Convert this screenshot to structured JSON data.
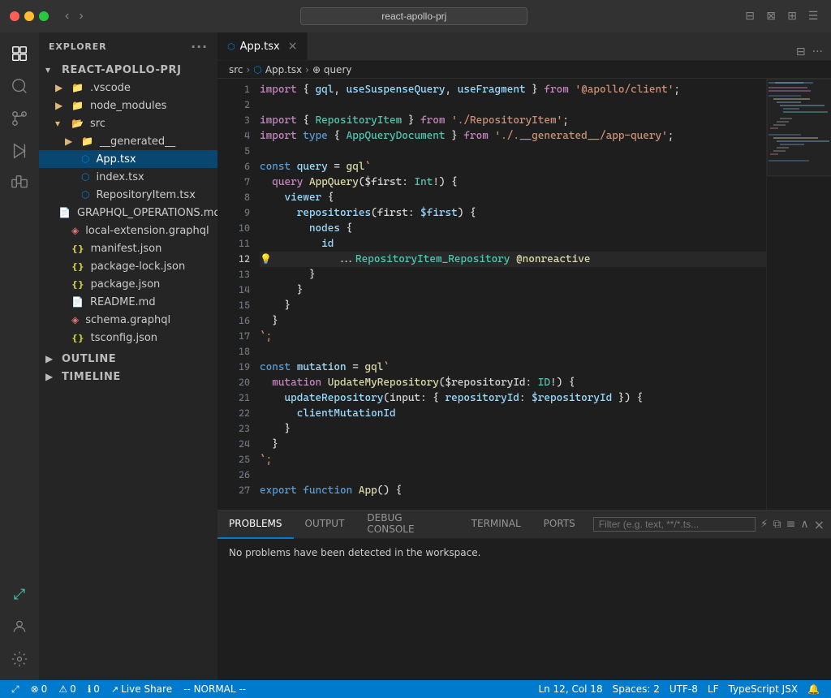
{
  "titlebar": {
    "search_placeholder": "react-apollo-prj",
    "icons": [
      "⊞",
      "⊟",
      "⊠"
    ]
  },
  "activity_bar": {
    "items": [
      {
        "id": "explorer",
        "icon": "⎘",
        "active": true
      },
      {
        "id": "search",
        "icon": "⌕"
      },
      {
        "id": "source-control",
        "icon": "⑂"
      },
      {
        "id": "run",
        "icon": "▷"
      },
      {
        "id": "extensions",
        "icon": "⊞"
      }
    ],
    "bottom": [
      {
        "id": "remote",
        "icon": "⤢"
      },
      {
        "id": "account",
        "icon": "👤"
      },
      {
        "id": "settings",
        "icon": "⚙"
      }
    ]
  },
  "sidebar": {
    "title": "EXPLORER",
    "tree": [
      {
        "id": "root",
        "label": "REACT-APOLLO-PRJ",
        "icon": "▾",
        "indent": 0,
        "type": "folder-open"
      },
      {
        "id": "vscode",
        "label": ".vscode",
        "icon": "▶",
        "indent": 1,
        "type": "folder"
      },
      {
        "id": "node_modules",
        "label": "node_modules",
        "icon": "▶",
        "indent": 1,
        "type": "folder"
      },
      {
        "id": "src",
        "label": "src",
        "icon": "▾",
        "indent": 1,
        "type": "folder-open"
      },
      {
        "id": "__generated__",
        "label": "__generated__",
        "icon": "▶",
        "indent": 2,
        "type": "folder"
      },
      {
        "id": "App.tsx",
        "label": "App.tsx",
        "icon": "⬡",
        "indent": 2,
        "type": "file-tsx",
        "active": true
      },
      {
        "id": "index.tsx",
        "label": "index.tsx",
        "icon": "⬡",
        "indent": 2,
        "type": "file-tsx"
      },
      {
        "id": "RepositoryItem.tsx",
        "label": "RepositoryItem.tsx",
        "icon": "⬡",
        "indent": 2,
        "type": "file-tsx"
      },
      {
        "id": "GRAPHQL_OPERATIONS.md",
        "label": "GRAPHQL_OPERATIONS.md",
        "icon": "📄",
        "indent": 1,
        "type": "file-md"
      },
      {
        "id": "local-extension.graphql",
        "label": "local-extension.graphql",
        "icon": "◈",
        "indent": 1,
        "type": "file-graphql"
      },
      {
        "id": "manifest.json",
        "label": "manifest.json",
        "icon": "{}",
        "indent": 1,
        "type": "file-json"
      },
      {
        "id": "package-lock.json",
        "label": "package-lock.json",
        "icon": "{}",
        "indent": 1,
        "type": "file-json"
      },
      {
        "id": "package.json",
        "label": "package.json",
        "icon": "{}",
        "indent": 1,
        "type": "file-json"
      },
      {
        "id": "README.md",
        "label": "README.md",
        "icon": "📄",
        "indent": 1,
        "type": "file-md"
      },
      {
        "id": "schema.graphql",
        "label": "schema.graphql",
        "icon": "◈",
        "indent": 1,
        "type": "file-graphql"
      },
      {
        "id": "tsconfig.json",
        "label": "tsconfig.json",
        "icon": "{}",
        "indent": 1,
        "type": "file-json"
      }
    ],
    "outline": "OUTLINE",
    "timeline": "TIMELINE"
  },
  "editor": {
    "tab_label": "App.tsx",
    "tab_icon": "⬡",
    "breadcrumb": [
      "src",
      "App.tsx",
      "query"
    ],
    "breadcrumb_sep": "›",
    "lines": [
      {
        "n": 1,
        "tokens": [
          {
            "t": "import",
            "c": "kw2"
          },
          {
            "t": " { ",
            "c": "plain"
          },
          {
            "t": "gql",
            "c": "var"
          },
          {
            "t": ", ",
            "c": "plain"
          },
          {
            "t": "useSuspenseQuery",
            "c": "var"
          },
          {
            "t": ", ",
            "c": "plain"
          },
          {
            "t": "useFragment",
            "c": "var"
          },
          {
            "t": " } ",
            "c": "plain"
          },
          {
            "t": "from",
            "c": "kw2"
          },
          {
            "t": " ",
            "c": "plain"
          },
          {
            "t": "'@apollo/client'",
            "c": "str"
          },
          {
            "t": ";",
            "c": "plain"
          }
        ]
      },
      {
        "n": 2,
        "tokens": []
      },
      {
        "n": 3,
        "tokens": [
          {
            "t": "import",
            "c": "kw2"
          },
          {
            "t": " { ",
            "c": "plain"
          },
          {
            "t": "RepositoryItem",
            "c": "type"
          },
          {
            "t": " } ",
            "c": "plain"
          },
          {
            "t": "from",
            "c": "kw2"
          },
          {
            "t": " ",
            "c": "plain"
          },
          {
            "t": "'./RepositoryItem'",
            "c": "str"
          },
          {
            "t": ";",
            "c": "plain"
          }
        ]
      },
      {
        "n": 4,
        "tokens": [
          {
            "t": "import",
            "c": "kw2"
          },
          {
            "t": " ",
            "c": "plain"
          },
          {
            "t": "type",
            "c": "kw"
          },
          {
            "t": " { ",
            "c": "plain"
          },
          {
            "t": "AppQueryDocument",
            "c": "type"
          },
          {
            "t": " } ",
            "c": "plain"
          },
          {
            "t": "from",
            "c": "kw2"
          },
          {
            "t": " ",
            "c": "plain"
          },
          {
            "t": "'./.__generated__/app-query'",
            "c": "str"
          },
          {
            "t": ";",
            "c": "plain"
          }
        ]
      },
      {
        "n": 5,
        "tokens": []
      },
      {
        "n": 6,
        "tokens": [
          {
            "t": "const",
            "c": "kw"
          },
          {
            "t": " ",
            "c": "plain"
          },
          {
            "t": "query",
            "c": "var"
          },
          {
            "t": " = ",
            "c": "plain"
          },
          {
            "t": "gql",
            "c": "fn"
          },
          {
            "t": "`",
            "c": "str"
          }
        ]
      },
      {
        "n": 7,
        "tokens": [
          {
            "t": "  query",
            "c": "kw2"
          },
          {
            "t": " ",
            "c": "plain"
          },
          {
            "t": "AppQuery",
            "c": "fn"
          },
          {
            "t": "($first: ",
            "c": "plain"
          },
          {
            "t": "Int",
            "c": "type"
          },
          {
            "t": "!) {",
            "c": "plain"
          }
        ]
      },
      {
        "n": 8,
        "tokens": [
          {
            "t": "    viewer",
            "c": "prop"
          },
          {
            "t": " {",
            "c": "plain"
          }
        ]
      },
      {
        "n": 9,
        "tokens": [
          {
            "t": "      repositories",
            "c": "prop"
          },
          {
            "t": "(first: ",
            "c": "plain"
          },
          {
            "t": "$first",
            "c": "var"
          },
          {
            "t": ") {",
            "c": "plain"
          }
        ]
      },
      {
        "n": 10,
        "tokens": [
          {
            "t": "        nodes",
            "c": "prop"
          },
          {
            "t": " {",
            "c": "plain"
          }
        ]
      },
      {
        "n": 11,
        "tokens": [
          {
            "t": "          id",
            "c": "prop"
          }
        ]
      },
      {
        "n": 12,
        "tokens": [
          {
            "t": "          ...",
            "c": "spread"
          },
          {
            "t": "RepositoryItem_Repository",
            "c": "type"
          },
          {
            "t": " ",
            "c": "plain"
          },
          {
            "t": "@nonreactive",
            "c": "decorator"
          }
        ],
        "active": true,
        "bulb": true
      },
      {
        "n": 13,
        "tokens": [
          {
            "t": "        }",
            "c": "plain"
          }
        ]
      },
      {
        "n": 14,
        "tokens": [
          {
            "t": "      }",
            "c": "plain"
          }
        ]
      },
      {
        "n": 15,
        "tokens": [
          {
            "t": "    }",
            "c": "plain"
          }
        ]
      },
      {
        "n": 16,
        "tokens": [
          {
            "t": "  }",
            "c": "plain"
          }
        ]
      },
      {
        "n": 17,
        "tokens": [
          {
            "t": "`;",
            "c": "str"
          }
        ]
      },
      {
        "n": 18,
        "tokens": []
      },
      {
        "n": 19,
        "tokens": [
          {
            "t": "const",
            "c": "kw"
          },
          {
            "t": " ",
            "c": "plain"
          },
          {
            "t": "mutation",
            "c": "var"
          },
          {
            "t": " = ",
            "c": "plain"
          },
          {
            "t": "gql",
            "c": "fn"
          },
          {
            "t": "`",
            "c": "str"
          }
        ]
      },
      {
        "n": 20,
        "tokens": [
          {
            "t": "  mutation",
            "c": "kw2"
          },
          {
            "t": " ",
            "c": "plain"
          },
          {
            "t": "UpdateMyRepository",
            "c": "fn"
          },
          {
            "t": "($repositoryId: ",
            "c": "plain"
          },
          {
            "t": "ID",
            "c": "type"
          },
          {
            "t": "!) {",
            "c": "plain"
          }
        ]
      },
      {
        "n": 21,
        "tokens": [
          {
            "t": "    updateRepository",
            "c": "prop"
          },
          {
            "t": "(input: { ",
            "c": "plain"
          },
          {
            "t": "repositoryId",
            "c": "prop"
          },
          {
            "t": ": ",
            "c": "plain"
          },
          {
            "t": "$repositoryId",
            "c": "var"
          },
          {
            "t": " }) {",
            "c": "plain"
          }
        ]
      },
      {
        "n": 22,
        "tokens": [
          {
            "t": "      clientMutationId",
            "c": "prop"
          }
        ]
      },
      {
        "n": 23,
        "tokens": [
          {
            "t": "    }",
            "c": "plain"
          }
        ]
      },
      {
        "n": 24,
        "tokens": [
          {
            "t": "  }",
            "c": "plain"
          }
        ]
      },
      {
        "n": 25,
        "tokens": [
          {
            "t": "`;",
            "c": "str"
          }
        ]
      },
      {
        "n": 26,
        "tokens": []
      },
      {
        "n": 27,
        "tokens": [
          {
            "t": "export",
            "c": "kw"
          },
          {
            "t": " ",
            "c": "plain"
          },
          {
            "t": "function",
            "c": "kw"
          },
          {
            "t": " ",
            "c": "plain"
          },
          {
            "t": "App",
            "c": "fn"
          },
          {
            "t": "() {",
            "c": "plain"
          }
        ]
      }
    ]
  },
  "panel": {
    "tabs": [
      {
        "id": "problems",
        "label": "PROBLEMS",
        "active": true
      },
      {
        "id": "output",
        "label": "OUTPUT"
      },
      {
        "id": "debug_console",
        "label": "DEBUG CONSOLE"
      },
      {
        "id": "terminal",
        "label": "TERMINAL"
      },
      {
        "id": "ports",
        "label": "PORTS"
      }
    ],
    "filter_placeholder": "Filter (e.g. text, **/*.ts...",
    "problems_message": "No problems have been detected in the workspace."
  },
  "statusbar": {
    "left": [
      {
        "id": "remote",
        "icon": "⤢",
        "label": ""
      },
      {
        "id": "errors",
        "icon": "⊗",
        "label": "0"
      },
      {
        "id": "warnings",
        "icon": "⚠",
        "label": "0"
      },
      {
        "id": "info",
        "icon": "ℹ",
        "label": "0"
      },
      {
        "id": "liveshare",
        "icon": "↗",
        "label": "Live Share"
      }
    ],
    "right": [
      {
        "id": "position",
        "label": "Ln 12, Col 18"
      },
      {
        "id": "spaces",
        "label": "Spaces: 2"
      },
      {
        "id": "encoding",
        "label": "UTF-8"
      },
      {
        "id": "eol",
        "label": "LF"
      },
      {
        "id": "language",
        "label": "TypeScript JSX"
      },
      {
        "id": "bell",
        "icon": "🔔",
        "label": ""
      }
    ],
    "vim_mode": "-- NORMAL --"
  }
}
